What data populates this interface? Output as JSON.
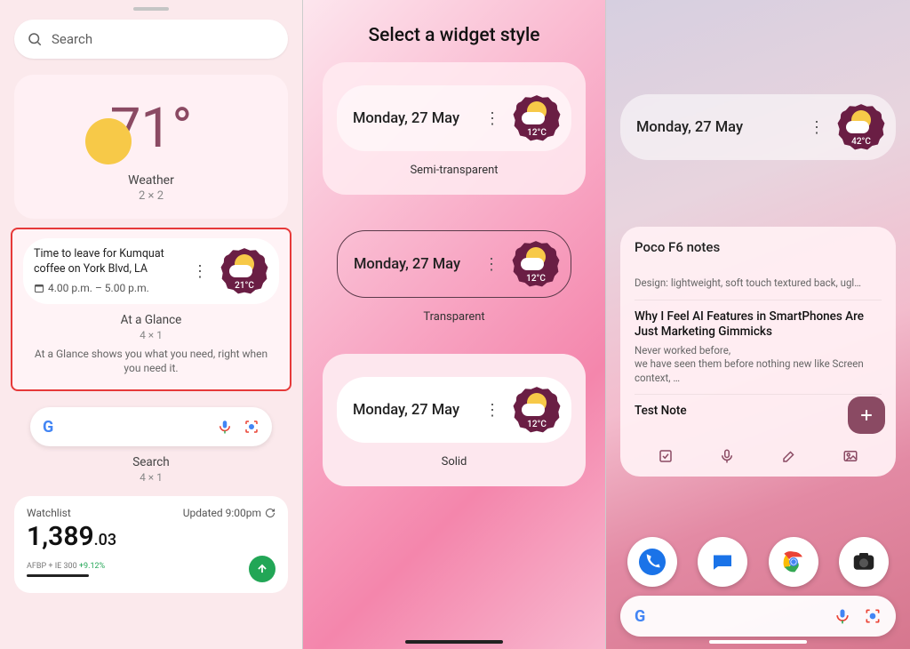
{
  "panel1": {
    "search_placeholder": "Search",
    "weather": {
      "temp": "71°",
      "title": "Weather",
      "size": "2 × 2"
    },
    "glance": {
      "headline": "Time to leave for Kumquat coffee on York Blvd, LA",
      "time": "4.00 p.m. – 5.00 p.m.",
      "temp": "21°C",
      "title": "At a Glance",
      "size": "4 × 1",
      "desc": "At a Glance shows you what you need, right when you need it."
    },
    "gsearch": {
      "title": "Search",
      "size": "4 × 1"
    },
    "finance": {
      "watchlist": "Watchlist",
      "updated": "Updated 9:00pm",
      "value_int": "1,389",
      "value_dec": ".03",
      "meta_prefix": "AFBP + IE 300 ",
      "meta_change": "+9.12%"
    }
  },
  "panel2": {
    "title": "Select a widget style",
    "date": "Monday, 27 May",
    "temp": "12°C",
    "styles": {
      "semi": "Semi-transparent",
      "trans": "Transparent",
      "solid": "Solid"
    }
  },
  "panel3": {
    "date": "Monday, 27 May",
    "temp": "42°C",
    "notes": {
      "title": "Poco F6 notes",
      "items": [
        {
          "t": "",
          "d": "Design: lightweight, soft touch textured back, ugl…"
        },
        {
          "t": "Why I Feel AI Features in SmartPhones Are Just Marketing Gimmicks",
          "d": "Never worked before,\nwe have seen them before nothing new like Screen context, …"
        },
        {
          "t": "Test Note",
          "d": ""
        }
      ]
    }
  }
}
